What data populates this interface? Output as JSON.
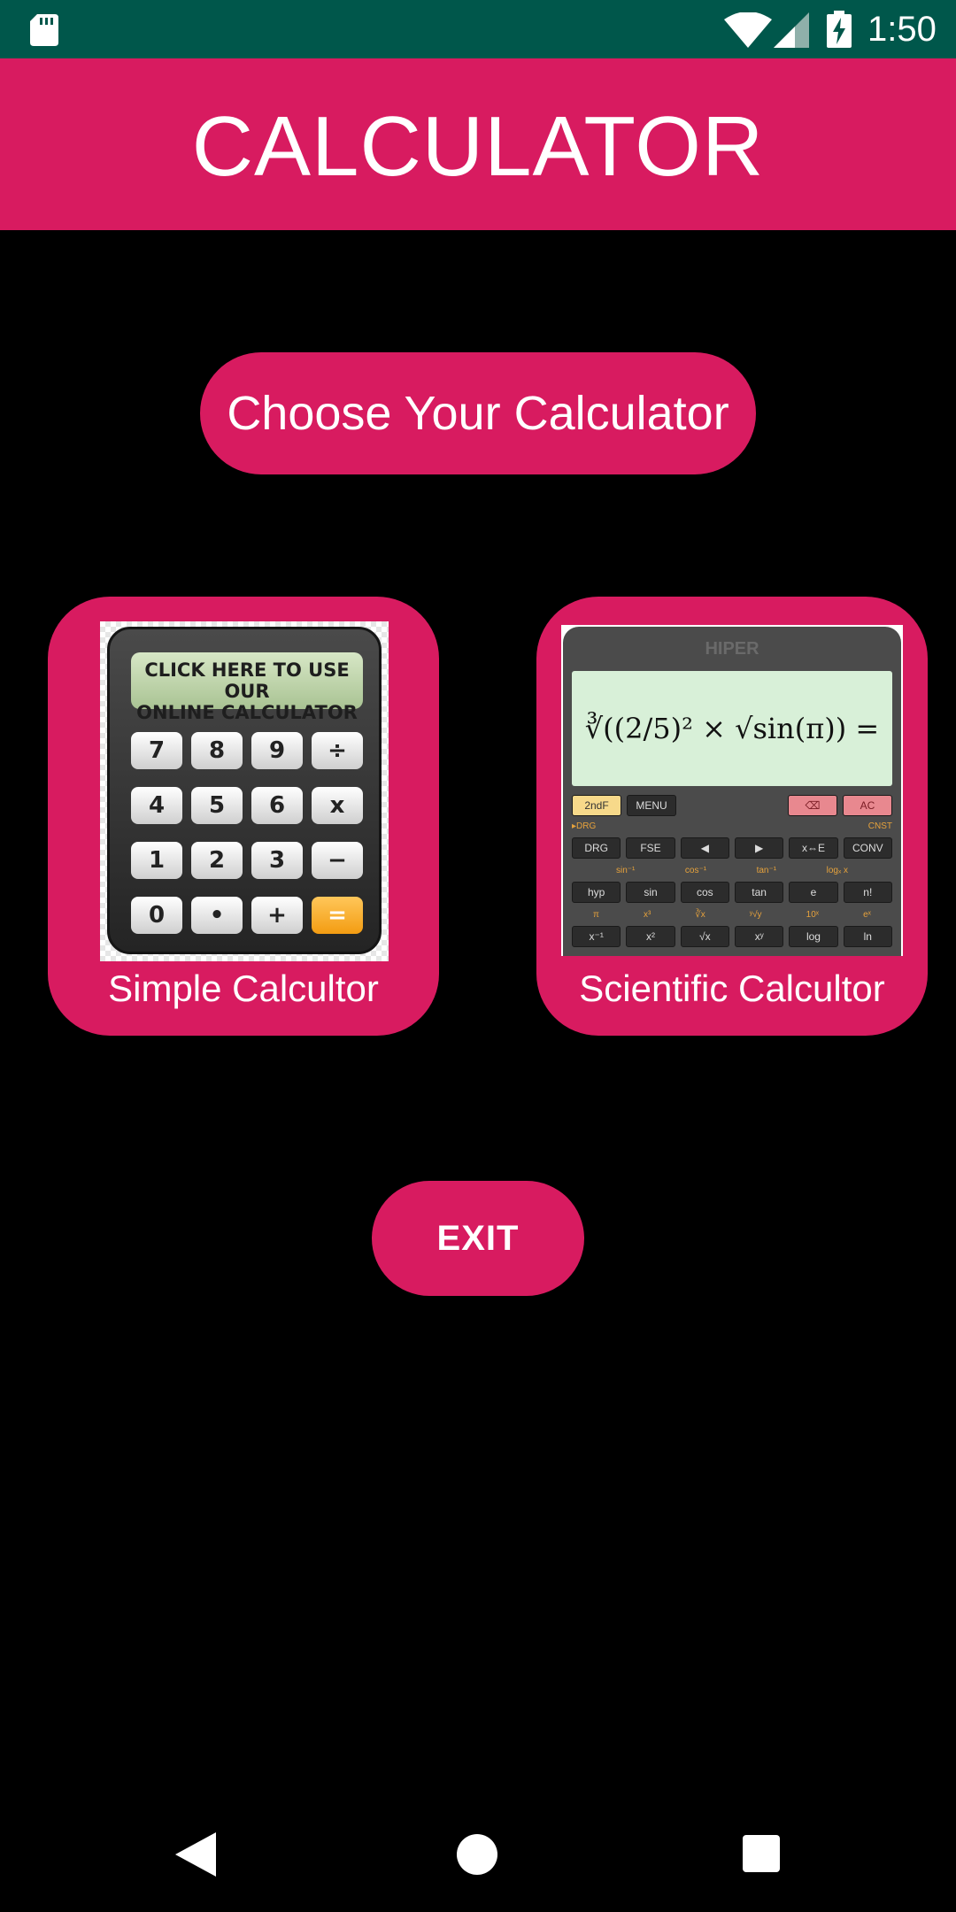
{
  "status_bar": {
    "time": "1:50"
  },
  "app_bar": {
    "title": "CALCULATOR"
  },
  "heading": {
    "label": "Choose Your Calculator"
  },
  "cards": {
    "simple": {
      "label": "Simple Calcultor",
      "display_line1": "CLICK HERE TO USE OUR",
      "display_line2": "ONLINE CALCULATOR",
      "keys": [
        "7",
        "8",
        "9",
        "÷",
        "4",
        "5",
        "6",
        "x",
        "1",
        "2",
        "3",
        "−",
        "0",
        "•",
        "+",
        "="
      ]
    },
    "scientific": {
      "label": "Scientific Calcultor",
      "brand": "HIPER",
      "screen_expression": "∛((2/5)² × √sin(π)) =",
      "row1": [
        "2ndF",
        "MENU",
        "",
        "",
        "⌫",
        "AC"
      ],
      "row2": [
        "DRG",
        "FSE",
        "◀",
        "▶",
        "x⇔E",
        "CONV"
      ],
      "row3": [
        "hyp",
        "sin",
        "cos",
        "tan",
        "e",
        "n!"
      ],
      "row4": [
        "x⁻¹",
        "x²",
        "√x",
        "xʸ",
        "log",
        "ln"
      ],
      "tiny1": [
        "▸DRG",
        "CNST"
      ],
      "tiny2": [
        "sin⁻¹",
        "cos⁻¹",
        "tan⁻¹",
        "logₓ x"
      ],
      "tiny3": [
        "π",
        "x³",
        "∛x",
        "ʸ√y",
        "10ˣ",
        "eˣ"
      ]
    }
  },
  "exit": {
    "label": "EXIT"
  }
}
